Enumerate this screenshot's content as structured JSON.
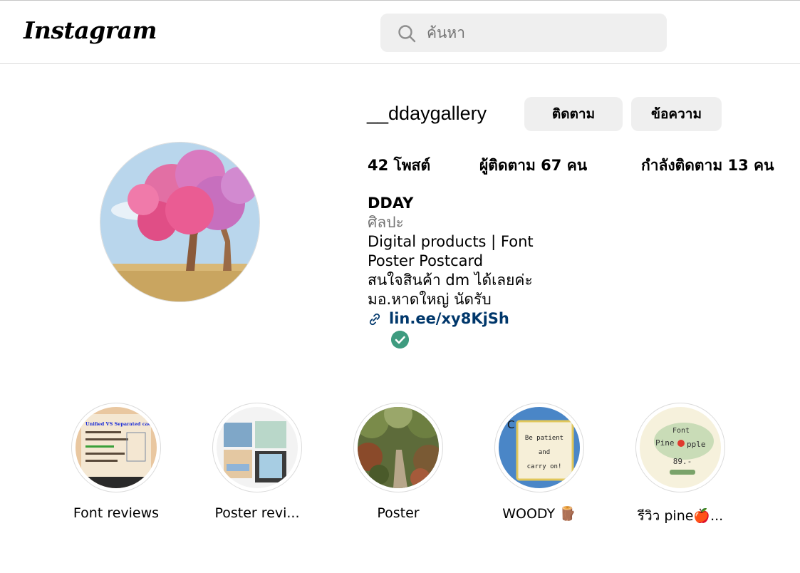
{
  "header": {
    "logo": "Instagram",
    "search": {
      "placeholder": "ค้นหา",
      "icon": "search-icon"
    }
  },
  "profile": {
    "username": "__ddaygallery",
    "follow_label": "ติดตาม",
    "message_label": "ข้อความ",
    "stats": {
      "posts": "42 โพสต์",
      "followers": "ผู้ติดตาม 67 คน",
      "following": "กำลังติดตาม 13 คน"
    },
    "bio": {
      "name": "DDAY",
      "category": "ศิลปะ",
      "lines": [
        "Digital products | Font",
        "Poster Postcard",
        "สนใจสินค้า dm ได้เลยค่ะ",
        "มอ.หาดใหญ่ นัดรับ"
      ],
      "link": "lin.ee/xy8KjSh"
    }
  },
  "highlights": [
    {
      "label": "Font reviews"
    },
    {
      "label": "Poster revi..."
    },
    {
      "label": "Poster"
    },
    {
      "label": "WOODY 🪵"
    },
    {
      "label": "รีวิว pine🍎..."
    }
  ],
  "highlight_text": {
    "font_review_title": "Unified VS Separated cache",
    "woody_lines": [
      "Be patient",
      "and",
      "carry on!"
    ],
    "woody_corner": "C",
    "pine_lines": [
      "Font",
      "Pine",
      "pple",
      "89.-"
    ]
  },
  "colors": {
    "link": "#00376b",
    "button_bg": "#efefef",
    "search_bg": "#efefef",
    "verified": "#3e9b7f",
    "secondary_text": "#737373"
  }
}
